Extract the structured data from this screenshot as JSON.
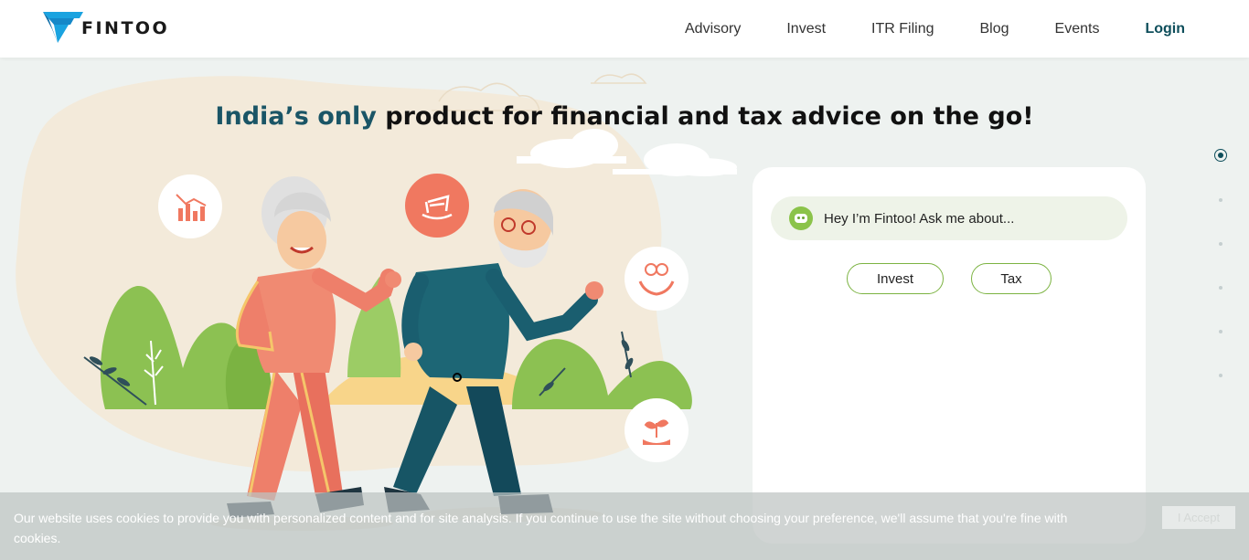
{
  "header": {
    "logo_text": "FINTOO",
    "nav": [
      "Advisory",
      "Invest",
      "ITR Filing",
      "Blog",
      "Events"
    ],
    "login": "Login"
  },
  "hero": {
    "headline_highlight": "India’s only",
    "headline_rest": " product for financial and tax advice on the go!"
  },
  "chat": {
    "greeting": "Hey I’m Fintoo! Ask me about...",
    "options": [
      "Invest",
      "Tax"
    ]
  },
  "cookie": {
    "text": "Our website uses cookies to provide you with personalized content and for site analysis. If you continue to use the site without choosing your preference, we'll assume that you're fine with cookies.",
    "accept": "I Accept"
  },
  "icons": [
    "chart-icon",
    "rocking-chair-icon",
    "rupee-hands-icon",
    "plant-hand-icon",
    "bot-icon"
  ],
  "colors": {
    "brand_blue": "#1aa3e0",
    "brand_teal": "#0e4e5b",
    "accent_green": "#7cb342",
    "coral": "#f07860"
  }
}
